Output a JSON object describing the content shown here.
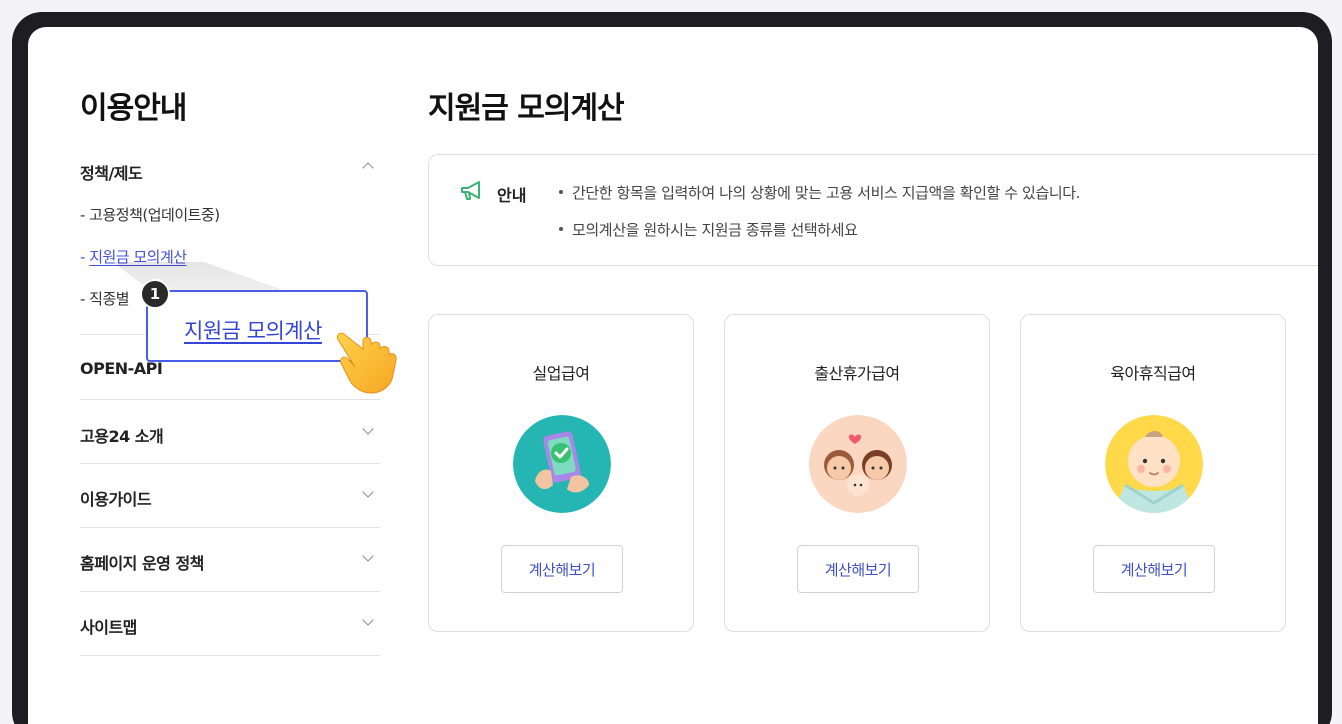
{
  "sidebar": {
    "title": "이용안내",
    "sections": [
      {
        "label": "정책/제도",
        "expanded": true
      },
      {
        "label": "OPEN-API"
      },
      {
        "label": "고용24 소개"
      },
      {
        "label": "이용가이드"
      },
      {
        "label": "홈페이지 운영 정책"
      },
      {
        "label": "사이트맵"
      }
    ],
    "sub_items": [
      {
        "label": "- 고용정책(업데이트중)"
      },
      {
        "prefix": "- ",
        "label": "지원금 모의계산",
        "active": true
      },
      {
        "label": "- 직종별"
      }
    ]
  },
  "callout": {
    "step": "1",
    "text": "지원금 모의계산"
  },
  "main": {
    "title": "지원금 모의계산",
    "notice": {
      "label": "안내",
      "lines": [
        "간단한 항목을 입력하여 나의 상황에 맞는 고용 서비스 지급액을 확인할 수 있습니다.",
        "모의계산을 원하시는 지원금 종류를 선택하세요"
      ]
    },
    "cards": [
      {
        "title": "실업급여",
        "button": "계산해보기",
        "icon": "phone-check-icon"
      },
      {
        "title": "출산휴가급여",
        "button": "계산해보기",
        "icon": "parents-baby-icon"
      },
      {
        "title": "육아휴직급여",
        "button": "계산해보기",
        "icon": "baby-face-icon"
      }
    ]
  },
  "colors": {
    "accent": "#4251e0",
    "frame": "#1e1e22",
    "notice_icon": "#3bb273"
  }
}
